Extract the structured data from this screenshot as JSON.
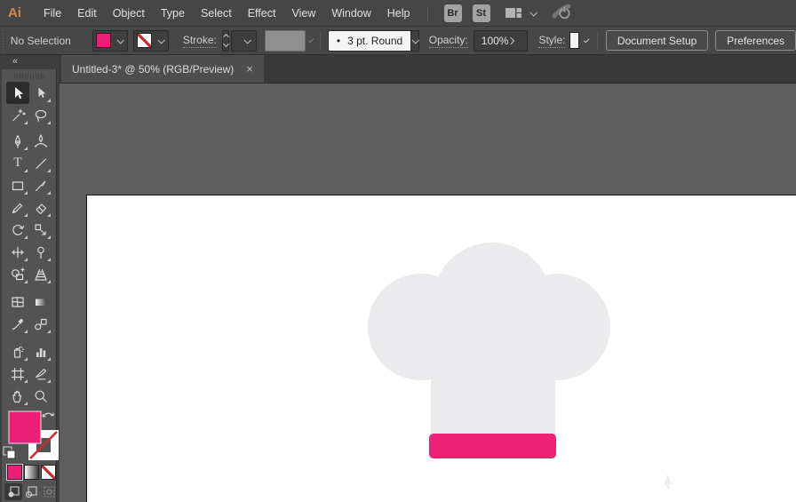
{
  "menubar": {
    "logo": "Ai",
    "items": [
      "File",
      "Edit",
      "Object",
      "Type",
      "Select",
      "Effect",
      "View",
      "Window",
      "Help"
    ],
    "bridge_badge": "Br",
    "stock_badge": "St",
    "icons": [
      "workspace-switcher-icon",
      "chevron-down-icon",
      "gpu-power-icon"
    ]
  },
  "controlbar": {
    "selection_status": "No Selection",
    "fill_color": "#ed1e78",
    "stroke_swatch": "none",
    "stroke_label": "Stroke:",
    "brush_dot": "•",
    "brush_value": "3 pt. Round",
    "opacity_label": "Opacity:",
    "opacity_value": "100%",
    "style_label": "Style:",
    "document_setup": "Document Setup",
    "preferences": "Preferences"
  },
  "tabbar": {
    "title": "Untitled-3* @ 50% (RGB/Preview)",
    "close_glyph": "×"
  },
  "toolbar": {
    "collapse_glyph": "«",
    "type_glyph": "T",
    "active_tool": "selection",
    "tools": [
      "selection",
      "direct-selection",
      "magic-wand",
      "lasso",
      "pen",
      "curvature",
      "type",
      "line-segment",
      "rectangle",
      "paintbrush",
      "shaper",
      "eraser",
      "rotate",
      "scale",
      "width",
      "puppet-warp",
      "shape-builder",
      "perspective-grid",
      "mesh",
      "gradient",
      "eyedropper",
      "blend",
      "symbol-sprayer",
      "column-graph",
      "artboard",
      "slice",
      "hand",
      "zoom"
    ],
    "fill_color": "#ed1e78",
    "stroke": "none",
    "drawing_modes": [
      "draw-normal",
      "draw-behind",
      "draw-inside"
    ],
    "active_drawing_mode": "draw-normal"
  },
  "artwork": {
    "shape": "chef-hat",
    "hat_color": "#ebebed",
    "band_color": "#ed2277"
  },
  "colors": {
    "ui_bar": "#474747",
    "panel": "#535353",
    "pasteboard": "#5e5e5e",
    "tabbar": "#3a3a3a",
    "accent_pink": "#ed1e78"
  }
}
